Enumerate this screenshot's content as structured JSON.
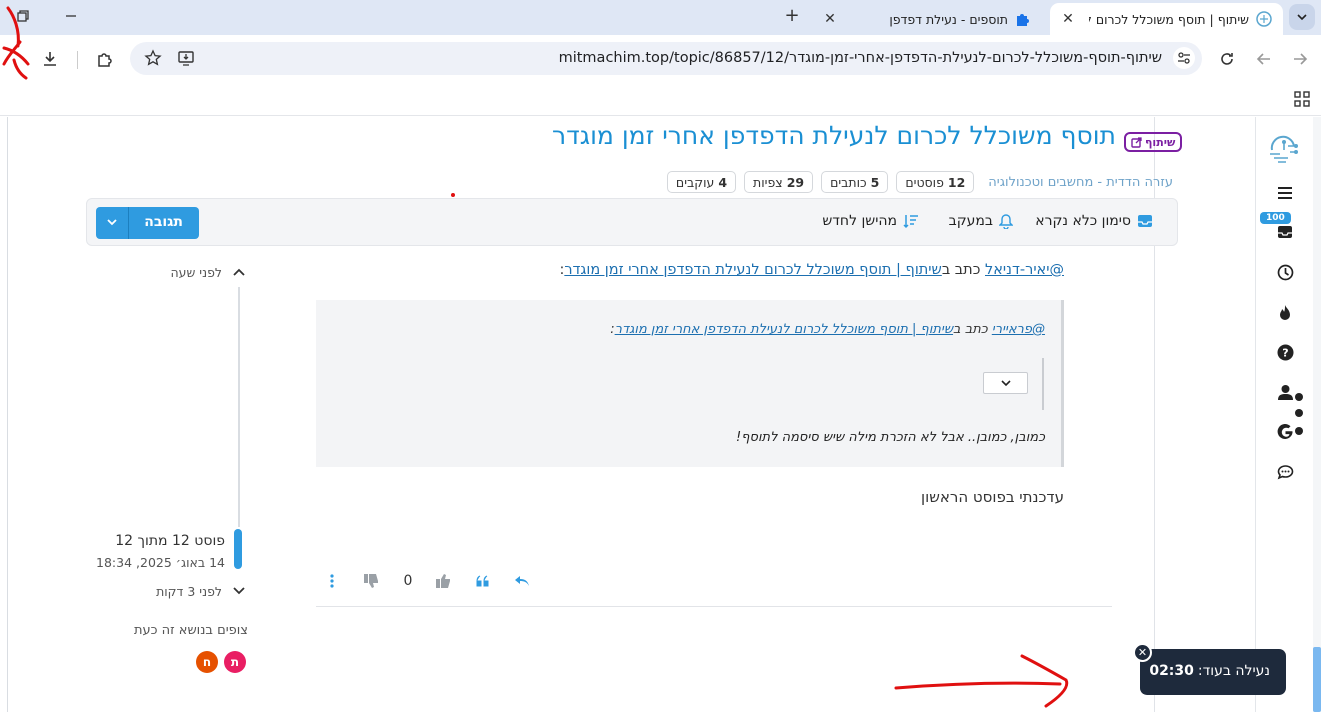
{
  "browser": {
    "tabs": [
      {
        "title": "שיתוף | תוסף משוכלל לכרום לנעילת הדפדפן אחרי זמן מוגדר",
        "active": true,
        "favicon": "site-logo-icon"
      },
      {
        "title": "תוספים - נעילת דפדפן",
        "active": false,
        "favicon": "puzzle-icon"
      }
    ],
    "url": "mitmachim.top/topic/86857/12/שיתוף-תוסף-משוכלל-לכרום-לנעילת-הדפדפן-אחרי-זמן-מוגדר"
  },
  "topic": {
    "title": "תוסף משוכלל לכרום לנעילת הדפדפן אחרי זמן מוגדר",
    "tag": "שיתוף",
    "category": "עזרה הדדית - מחשבים וטכנולוגיה",
    "stats": [
      {
        "num": "12",
        "label": "פוסטים"
      },
      {
        "num": "5",
        "label": "כותבים"
      },
      {
        "num": "29",
        "label": "צפיות"
      },
      {
        "num": "4",
        "label": "עוקבים"
      }
    ]
  },
  "actions": {
    "mark_read": "סימון כלא נקרא",
    "watching": "במעקב",
    "sort": "מהישן לחדש",
    "reply": "תגובה"
  },
  "timeline": {
    "top_time": "לפני שעה",
    "position": "פוסט 12 מתוך 12",
    "date": "14 באוג׳ 2025, 18:34",
    "bottom_time": "לפני 3 דקות"
  },
  "post": {
    "quote_user": "@יאיר-דניאל",
    "wrote_in": "כתב ב",
    "quote_link": "שיתוף | תוסף משוכלל לכרום לנעילת הדפדפן אחרי זמן מוגדר",
    "colon": ":",
    "nested_user": "@פראיירי",
    "nested_wrote": "כתב ב",
    "nested_link": "שיתוף | תוסף משוכלל לכרום לנעילת הדפדפן אחרי זמן מוגדר",
    "nested_colon": ":",
    "quote_text": "כמובן, כמובן.. אבל לא הזכרת מילה שיש סיסמה לתוסף!",
    "body": "עדכנתי בפוסט הראשון",
    "votes": "0"
  },
  "watchers": {
    "label": "צופים בנושא זה כעת",
    "avatars": [
      {
        "letter": "ת",
        "color": "#e91e63"
      },
      {
        "letter": "ח",
        "color": "#e65100"
      }
    ]
  },
  "sidebar": {
    "badge": "100"
  },
  "toast": {
    "label": "נעילה בעוד:",
    "time": "02:30"
  },
  "colors": {
    "accent": "#2f9be0",
    "title": "#1a8fd3",
    "tag": "#7b1fa2",
    "toast_bg": "#1e2a3c",
    "annotation": "#e01010"
  }
}
